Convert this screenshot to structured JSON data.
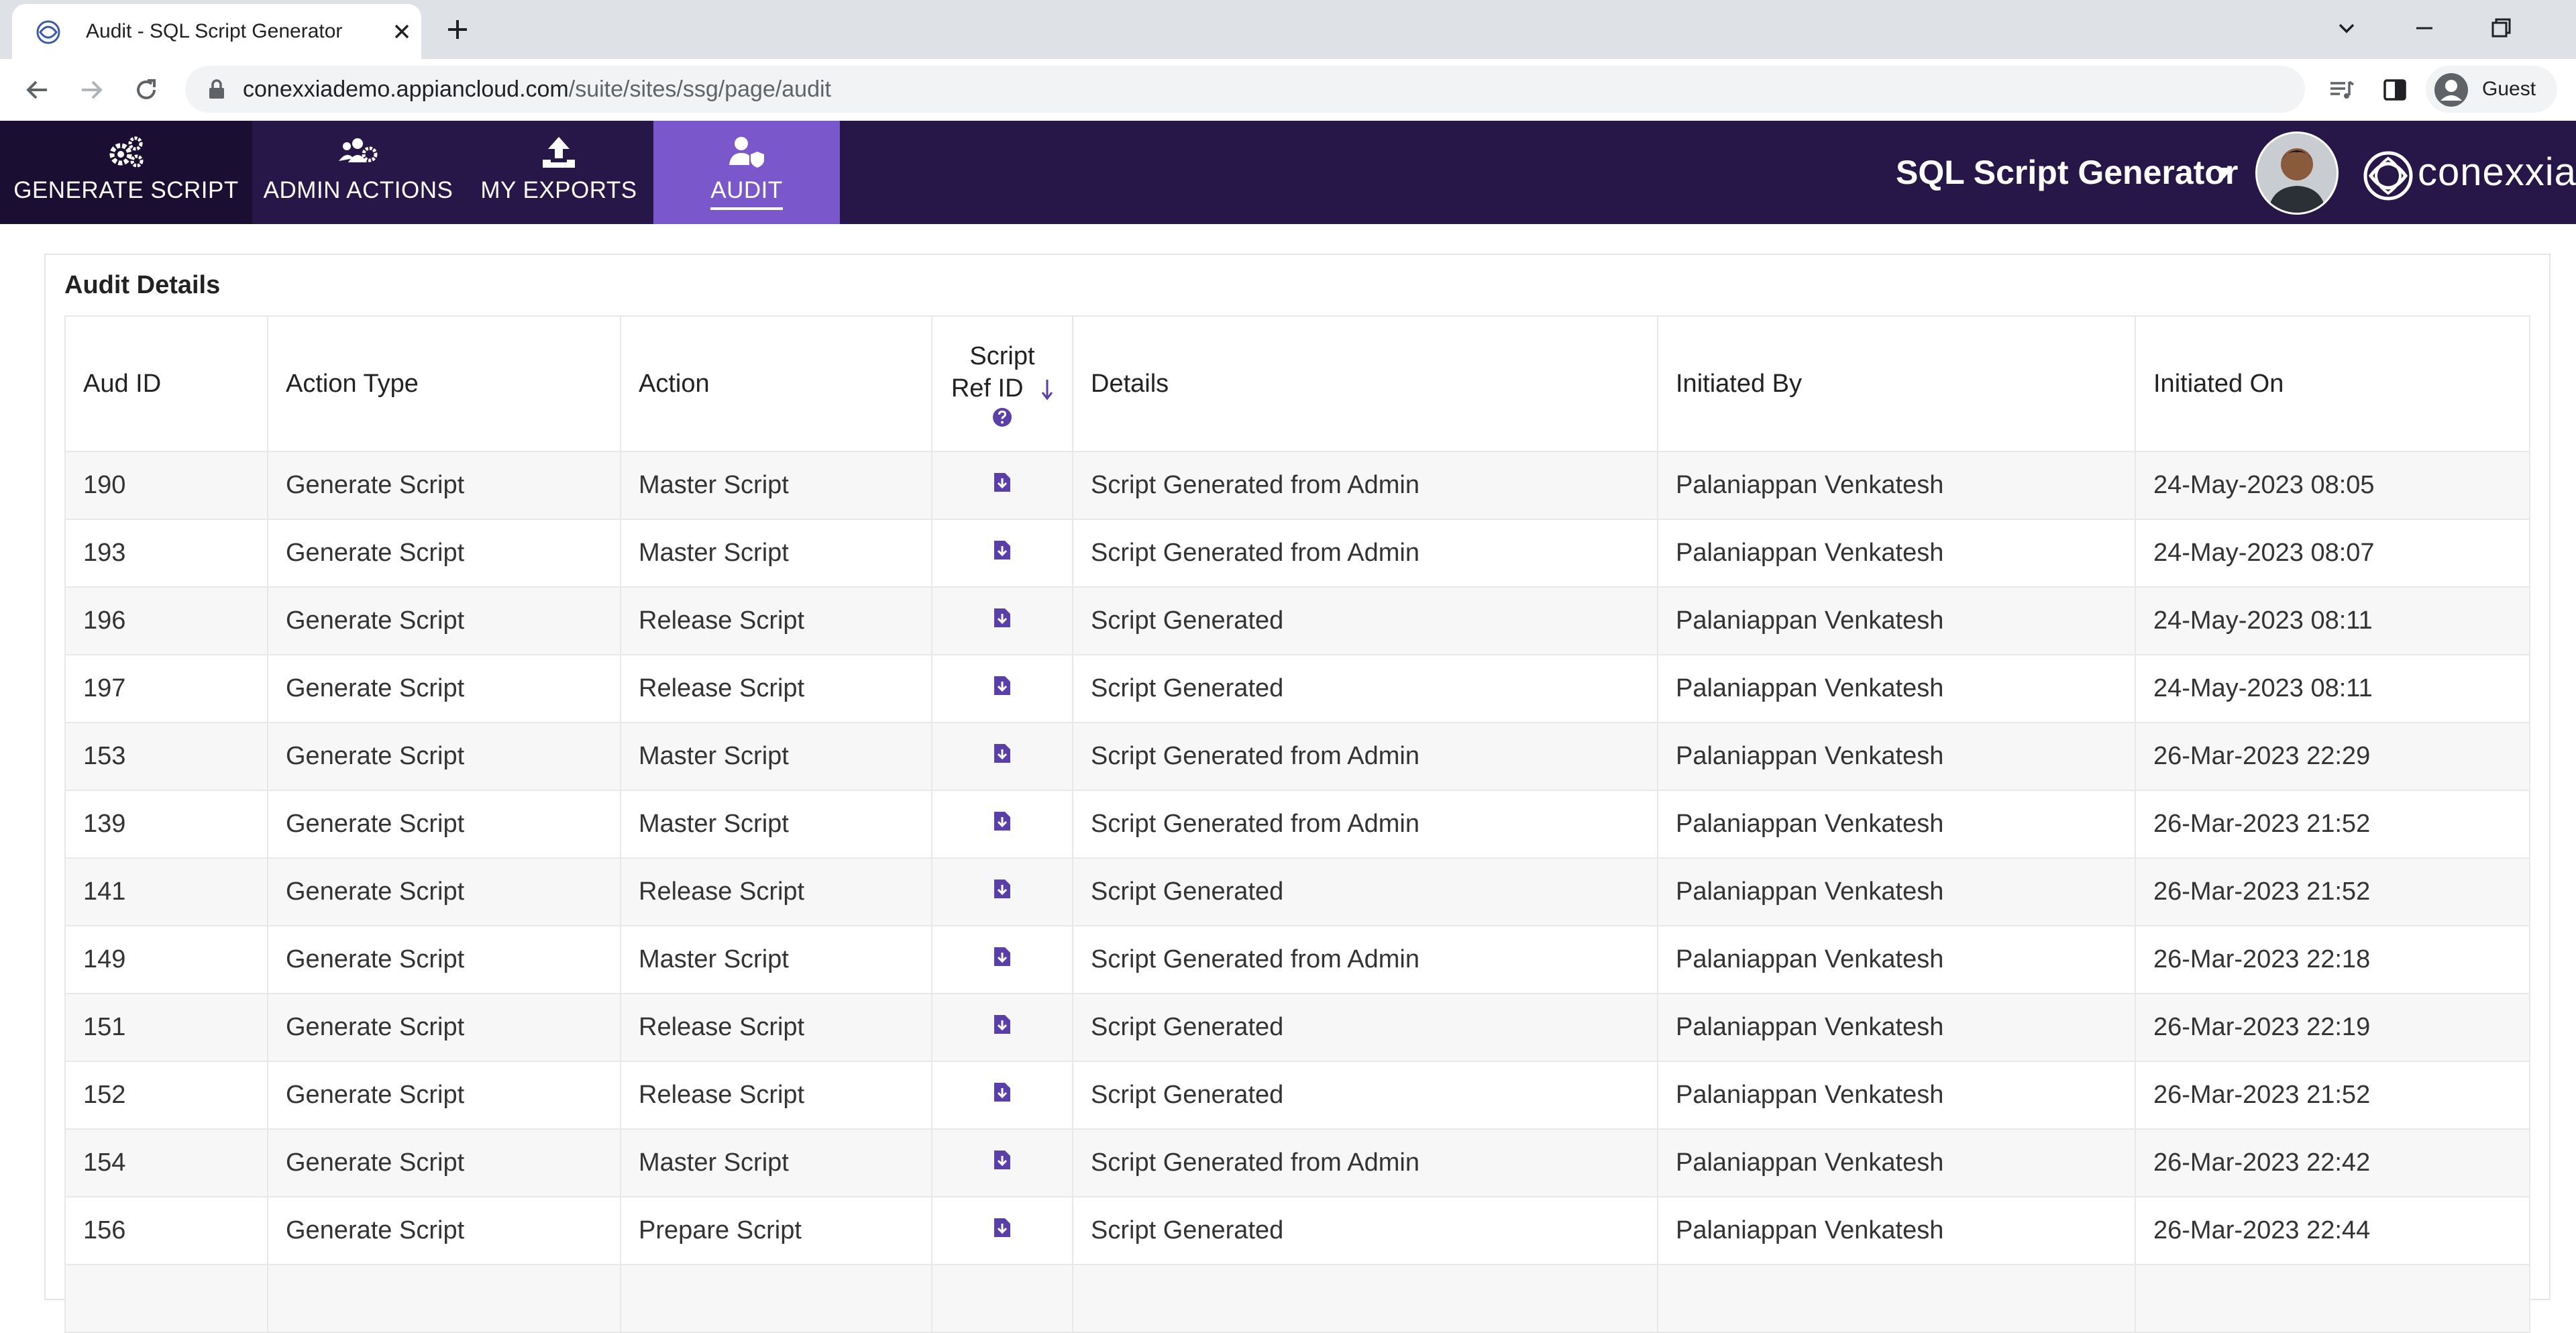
{
  "browser": {
    "tab_title": "Audit - SQL Script Generator",
    "url_host": "conexxiademo.appiancloud.com",
    "url_path": "/suite/sites/ssg/page/audit",
    "profile_label": "Guest"
  },
  "header": {
    "nav": [
      {
        "label": "GENERATE SCRIPT",
        "icon": "gears-icon"
      },
      {
        "label": "ADMIN ACTIONS",
        "icon": "users-gear-icon"
      },
      {
        "label": "MY EXPORTS",
        "icon": "upload-icon"
      },
      {
        "label": "AUDIT",
        "icon": "user-shield-icon"
      }
    ],
    "site_title": "SQL Script Generator",
    "brand": "conexxia"
  },
  "audit": {
    "title": "Audit Details",
    "columns": {
      "aud_id": "Aud ID",
      "action_type": "Action Type",
      "action": "Action",
      "script_ref_line1": "Script",
      "script_ref_line2": "Ref ID",
      "details": "Details",
      "initiated_by": "Initiated By",
      "initiated_on": "Initiated On"
    },
    "rows": [
      {
        "aud_id": "190",
        "action_type": "Generate Script",
        "action": "Master Script",
        "details": "Script Generated from Admin",
        "initiated_by": "Palaniappan Venkatesh",
        "initiated_on": "24-May-2023 08:05"
      },
      {
        "aud_id": "193",
        "action_type": "Generate Script",
        "action": "Master Script",
        "details": "Script Generated from Admin",
        "initiated_by": "Palaniappan Venkatesh",
        "initiated_on": "24-May-2023 08:07"
      },
      {
        "aud_id": "196",
        "action_type": "Generate Script",
        "action": "Release Script",
        "details": "Script Generated",
        "initiated_by": "Palaniappan Venkatesh",
        "initiated_on": "24-May-2023 08:11"
      },
      {
        "aud_id": "197",
        "action_type": "Generate Script",
        "action": "Release Script",
        "details": "Script Generated",
        "initiated_by": "Palaniappan Venkatesh",
        "initiated_on": "24-May-2023 08:11"
      },
      {
        "aud_id": "153",
        "action_type": "Generate Script",
        "action": "Master Script",
        "details": "Script Generated from Admin",
        "initiated_by": "Palaniappan Venkatesh",
        "initiated_on": "26-Mar-2023 22:29"
      },
      {
        "aud_id": "139",
        "action_type": "Generate Script",
        "action": "Master Script",
        "details": "Script Generated from Admin",
        "initiated_by": "Palaniappan Venkatesh",
        "initiated_on": "26-Mar-2023 21:52"
      },
      {
        "aud_id": "141",
        "action_type": "Generate Script",
        "action": "Release Script",
        "details": "Script Generated",
        "initiated_by": "Palaniappan Venkatesh",
        "initiated_on": "26-Mar-2023 21:52"
      },
      {
        "aud_id": "149",
        "action_type": "Generate Script",
        "action": "Master Script",
        "details": "Script Generated from Admin",
        "initiated_by": "Palaniappan Venkatesh",
        "initiated_on": "26-Mar-2023 22:18"
      },
      {
        "aud_id": "151",
        "action_type": "Generate Script",
        "action": "Release Script",
        "details": "Script Generated",
        "initiated_by": "Palaniappan Venkatesh",
        "initiated_on": "26-Mar-2023 22:19"
      },
      {
        "aud_id": "152",
        "action_type": "Generate Script",
        "action": "Release Script",
        "details": "Script Generated",
        "initiated_by": "Palaniappan Venkatesh",
        "initiated_on": "26-Mar-2023 21:52"
      },
      {
        "aud_id": "154",
        "action_type": "Generate Script",
        "action": "Master Script",
        "details": "Script Generated from Admin",
        "initiated_by": "Palaniappan Venkatesh",
        "initiated_on": "26-Mar-2023 22:42"
      },
      {
        "aud_id": "156",
        "action_type": "Generate Script",
        "action": "Prepare Script",
        "details": "Script Generated",
        "initiated_by": "Palaniappan Venkatesh",
        "initiated_on": "26-Mar-2023 22:44"
      },
      {
        "aud_id": "",
        "action_type": "",
        "action": "",
        "details": "",
        "initiated_by": "",
        "initiated_on": ""
      }
    ]
  },
  "colors": {
    "header_bg": "#261748",
    "active_tab": "#7b57cc",
    "first_tab": "#1a0f33",
    "accent_icon": "#5b3fa8"
  }
}
